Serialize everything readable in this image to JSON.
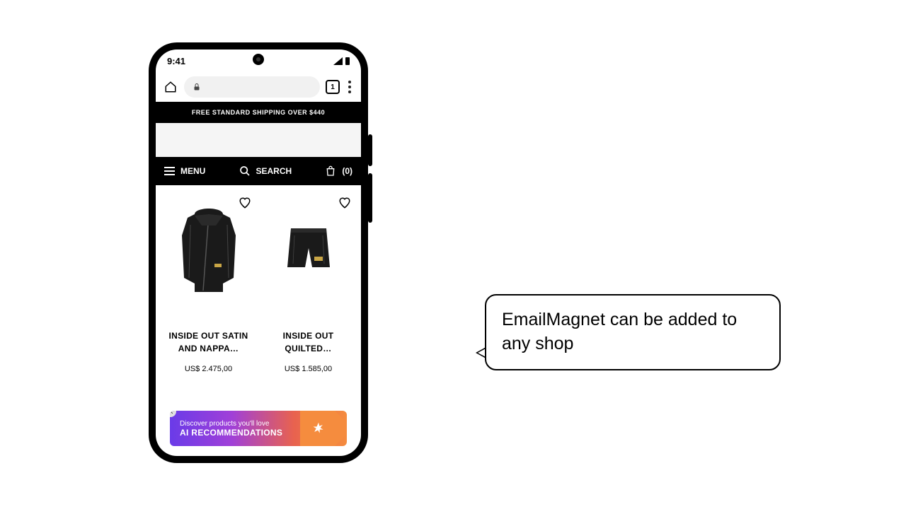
{
  "status": {
    "time": "9:41"
  },
  "browser": {
    "tab_count": "1"
  },
  "banner": {
    "shipping": "FREE STANDARD SHIPPING OVER $440"
  },
  "nav": {
    "menu_label": "MENU",
    "search_label": "SEARCH",
    "cart_label": "(0)"
  },
  "products": [
    {
      "title_line1": "INSIDE OUT SATIN",
      "title_line2": "AND NAPPA…",
      "price": "US$ 2.475,00"
    },
    {
      "title_line1": "INSIDE OUT",
      "title_line2": "QUILTED…",
      "price": "US$ 1.585,00"
    }
  ],
  "ai_banner": {
    "subtitle": "Discover products you'll love",
    "title": "AI RECOMMENDATIONS"
  },
  "callout": {
    "text": "EmailMagnet can be added to any shop"
  }
}
